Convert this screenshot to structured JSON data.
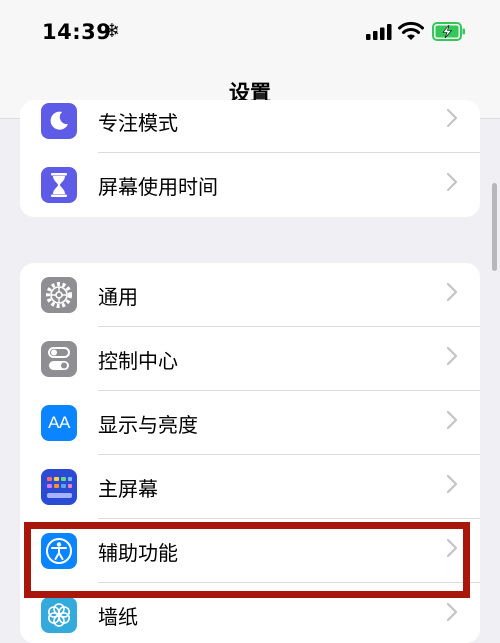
{
  "status_bar": {
    "time": "14:39",
    "extra_icon": "snowflake-icon",
    "signal_icon": "cellular-signal-icon",
    "wifi_icon": "wifi-icon",
    "battery_icon": "battery-charging-icon"
  },
  "nav": {
    "title": "设置"
  },
  "groups": [
    {
      "items": [
        {
          "label": "专注模式",
          "icon": "moon-icon",
          "color": "#5e5ce6"
        },
        {
          "label": "屏幕使用时间",
          "icon": "hourglass-icon",
          "color": "#5e5ce6"
        }
      ]
    },
    {
      "items": [
        {
          "label": "通用",
          "icon": "gear-icon",
          "color": "#8e8e93"
        },
        {
          "label": "控制中心",
          "icon": "toggle-icon",
          "color": "#8e8e93"
        },
        {
          "label": "显示与亮度",
          "icon": "text-size-icon",
          "icon_text": "AA",
          "color": "#0a84ff"
        },
        {
          "label": "主屏幕",
          "icon": "app-grid-icon",
          "color": "#3b5bdb"
        },
        {
          "label": "辅助功能",
          "icon": "accessibility-icon",
          "color": "#0a84ff",
          "highlighted": true
        },
        {
          "label": "墙纸",
          "icon": "flower-icon",
          "color": "#34aadc"
        }
      ]
    }
  ],
  "highlight_color": "#a8160c"
}
